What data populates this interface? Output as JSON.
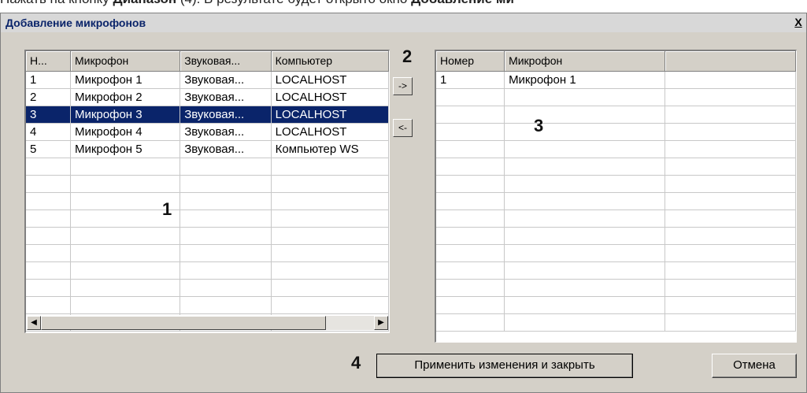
{
  "doc_line": {
    "part1": "Нажать на кнопку ",
    "bold1": "Диапазон",
    "part2": " (4). В результате будет открыто окно ",
    "bold2": "Добавление ми"
  },
  "window": {
    "title": "Добавление микрофонов",
    "close_label": "X"
  },
  "left_table": {
    "headers": [
      "Н...",
      "Микрофон",
      "Звуковая...",
      "Компьютер"
    ],
    "rows": [
      [
        "1",
        "Микрофон 1",
        "Звуковая...",
        "LOCALHOST"
      ],
      [
        "2",
        "Микрофон 2",
        "Звуковая...",
        "LOCALHOST"
      ],
      [
        "3",
        "Микрофон 3",
        "Звуковая...",
        "LOCALHOST"
      ],
      [
        "4",
        "Микрофон 4",
        "Звуковая...",
        "LOCALHOST"
      ],
      [
        "5",
        "Микрофон 5",
        "Звуковая...",
        "Компьютер WS"
      ]
    ],
    "selected_row": 3
  },
  "right_table": {
    "headers": [
      "Номер",
      "Микрофон",
      ""
    ],
    "rows": [
      [
        "1",
        "Микрофон 1",
        ""
      ]
    ]
  },
  "move_buttons": {
    "add_label": "->",
    "remove_label": "<-"
  },
  "buttons": {
    "apply_label": "Применить изменения и закрыть",
    "cancel_label": "Отмена"
  },
  "annotations": {
    "a1": "1",
    "a2": "2",
    "a3": "3",
    "a4": "4"
  }
}
